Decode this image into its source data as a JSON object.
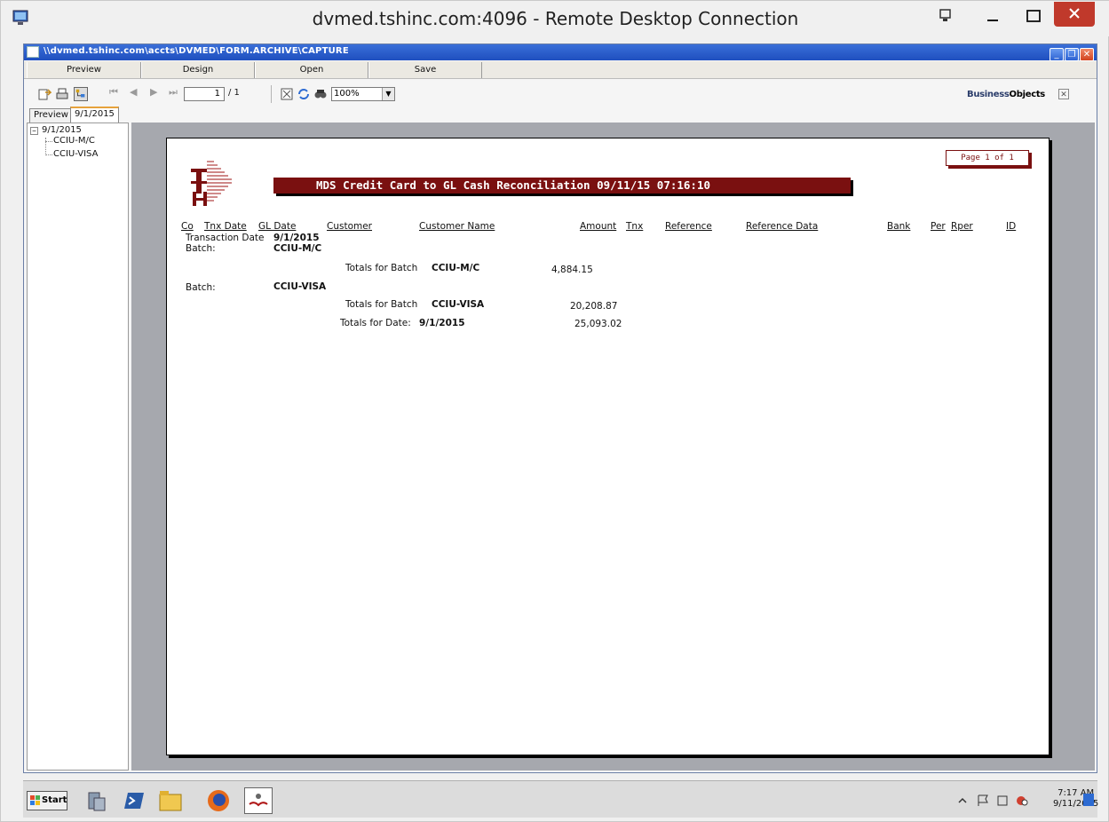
{
  "rdp": {
    "title": "dvmed.tshinc.com:4096 - Remote Desktop Connection"
  },
  "app": {
    "title": "\\\\dvmed.tshinc.com\\accts\\DVMED\\FORM.ARCHIVE\\CAPTURE",
    "menu": [
      "Preview",
      "Design",
      "Open",
      "Save"
    ],
    "toolbar": {
      "page_current": "1",
      "page_total": "/ 1",
      "zoom": "100%",
      "brand_prefix": "Business",
      "brand_suffix": "Objects"
    },
    "tabs": [
      "Preview",
      "9/1/2015"
    ],
    "tree": {
      "root": "9/1/2015",
      "children": [
        "CCIU-M/C",
        "CCIU-VISA"
      ]
    }
  },
  "report": {
    "title": "MDS Credit Card to GL Cash Reconciliation  09/11/15 07:16:10",
    "page_label": "Page 1 of 1",
    "columns": [
      "Co",
      "Tnx Date",
      "GL Date",
      "Customer",
      "Customer Name",
      "Amount",
      "Tnx",
      "Reference",
      "Reference Data",
      "Bank",
      "Per",
      "Rper",
      "ID"
    ],
    "transaction_date_label": "Transaction Date",
    "transaction_date_value": "9/1/2015",
    "batch_label": "Batch:",
    "batches": [
      {
        "name": "CCIU-M/C",
        "totals_label": "Totals for Batch",
        "total": "4,884.15"
      },
      {
        "name": "CCIU-VISA",
        "totals_label": "Totals for Batch",
        "total": "20,208.87"
      }
    ],
    "date_totals_label": "Totals for Date:",
    "date_totals_value": "9/1/2015",
    "date_total": "25,093.02"
  },
  "taskbar": {
    "start_label": "Start",
    "time": "7:17 AM",
    "date": "9/11/2015"
  },
  "colors": {
    "report_accent": "#7a1010",
    "preview_bg": "#a6a8ae",
    "app_titlebar": "#1f4fbf",
    "rdp_close": "#c0392b"
  }
}
